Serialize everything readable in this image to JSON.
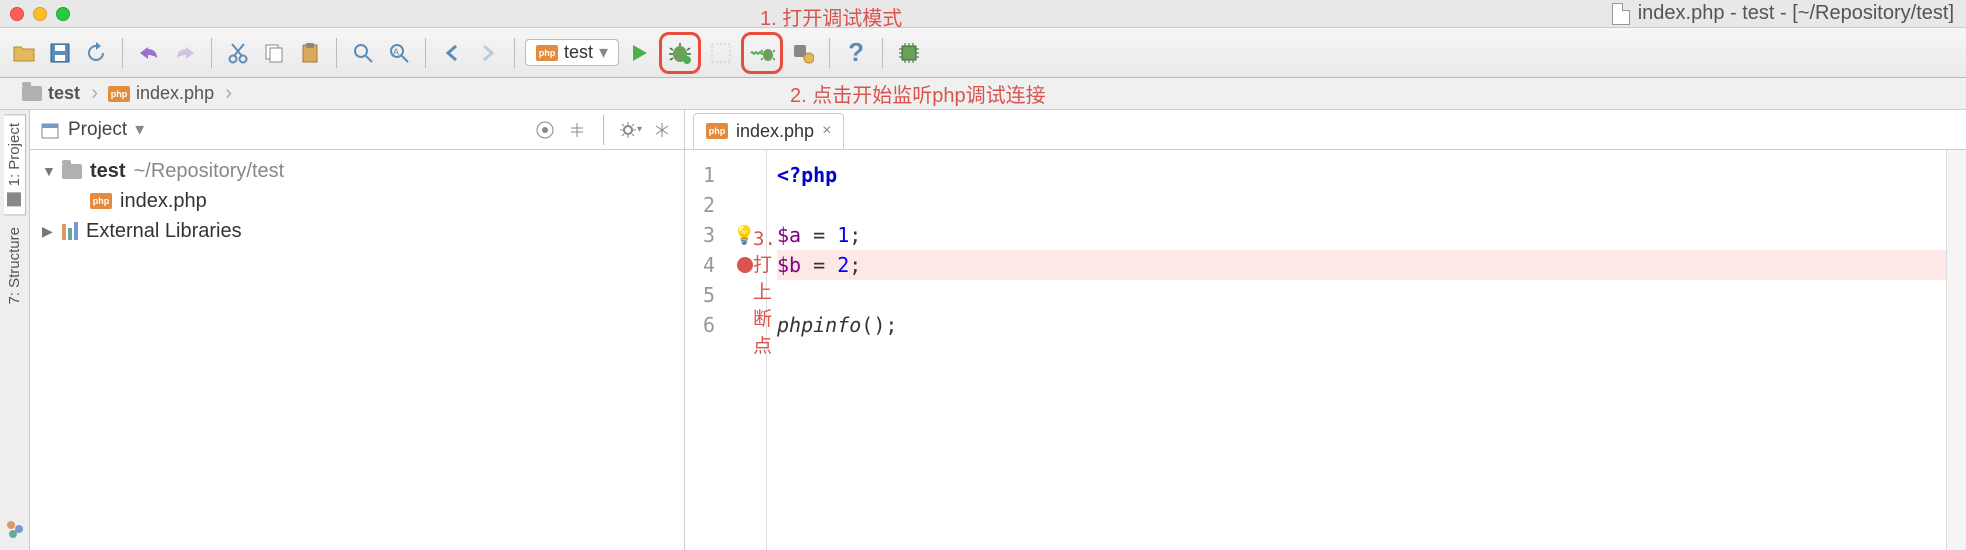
{
  "window": {
    "title": "index.php - test - [~/Repository/test]"
  },
  "annotations": {
    "a1": "1. 打开调试模式",
    "a2": "2. 点击开始监听php调试连接",
    "a3": "3. 打上断点"
  },
  "run_config": {
    "label": "test"
  },
  "breadcrumb": {
    "p1": "test",
    "p2": "index.php"
  },
  "project": {
    "panel_title": "Project",
    "root_name": "test",
    "root_path": "~/Repository/test",
    "file1": "index.php",
    "ext_lib": "External Libraries"
  },
  "left_rail": {
    "project": "1: Project",
    "structure": "7: Structure"
  },
  "editor": {
    "tab": "index.php",
    "gutter": {
      "l1": "1",
      "l2": "2",
      "l3": "3",
      "l4": "4",
      "l5": "5",
      "l6": "6"
    },
    "code": {
      "open": "<?php",
      "va": "$a",
      "vb": "$b",
      "eq": " = ",
      "one": "1",
      "two": "2",
      "semi": ";",
      "call": "phpinfo",
      "parens": "();"
    }
  }
}
